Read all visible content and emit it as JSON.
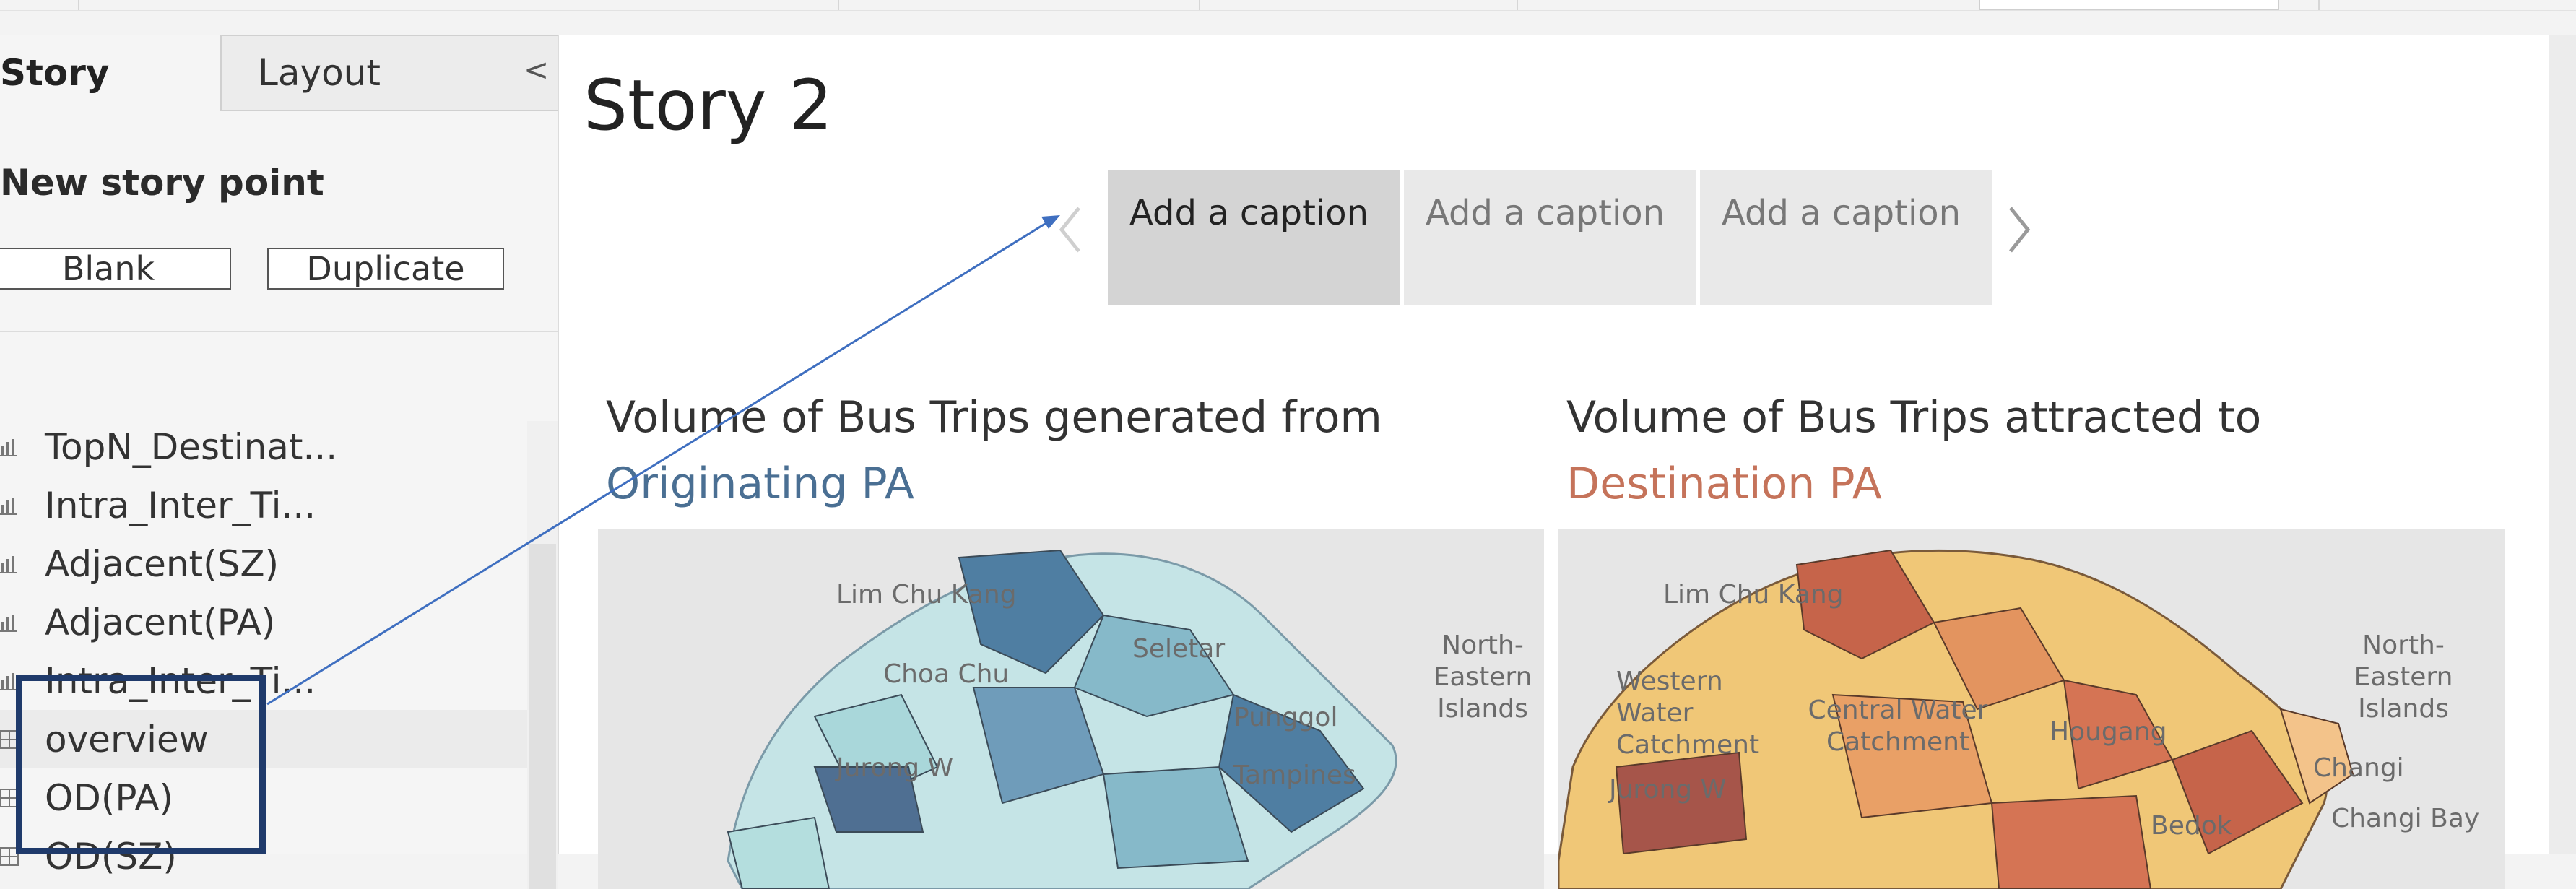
{
  "left_pane": {
    "tabs": [
      "Story",
      "Layout"
    ],
    "collapse_icon": "<",
    "new_story_point": "New story point",
    "buttons": {
      "blank": "Blank",
      "duplicate": "Duplicate"
    },
    "sheets": [
      {
        "label": "TopN_Destinat...",
        "icon": "bar-chart-icon"
      },
      {
        "label": "Intra_Inter_Ti...",
        "icon": "bar-chart-icon"
      },
      {
        "label": "Adjacent(SZ)",
        "icon": "bar-chart-icon"
      },
      {
        "label": "Adjacent(PA)",
        "icon": "bar-chart-icon"
      },
      {
        "label": "Intra_Inter_Ti...",
        "icon": "bar-chart-icon"
      },
      {
        "label": "overview",
        "icon": "dashboard-icon"
      },
      {
        "label": "OD(PA)",
        "icon": "dashboard-icon"
      },
      {
        "label": "OD(SZ)",
        "icon": "dashboard-icon"
      }
    ]
  },
  "main": {
    "story_title": "Story 2",
    "captions": [
      "Add a caption",
      "Add a caption",
      "Add a caption"
    ],
    "nav": {
      "prev": "‹",
      "next": "›"
    },
    "viz_left": {
      "title": "Volume of Bus Trips generated from",
      "highlight": "Originating PA",
      "labels": [
        "Lim Chu Kang",
        "Choa Chu",
        "Jurong W",
        "North-Eastern Islands",
        "Seletar",
        "Punggol",
        "Tampines"
      ]
    },
    "viz_right": {
      "title": "Volume of Bus Trips attracted to",
      "highlight": "Destination PA",
      "labels": [
        "Lim Chu Kang",
        "Western Water Catchment",
        "Central Water Catchment",
        "Jurong W",
        "North-Eastern Islands",
        "Changi",
        "Changi Bay",
        "Bedok",
        "Hougang"
      ]
    }
  },
  "colors": {
    "selection_box": "#1f3a6b",
    "annotation_arrow": "#3f6fc0",
    "highlight_blue": "#4a6f93",
    "highlight_orange": "#c5735a"
  }
}
